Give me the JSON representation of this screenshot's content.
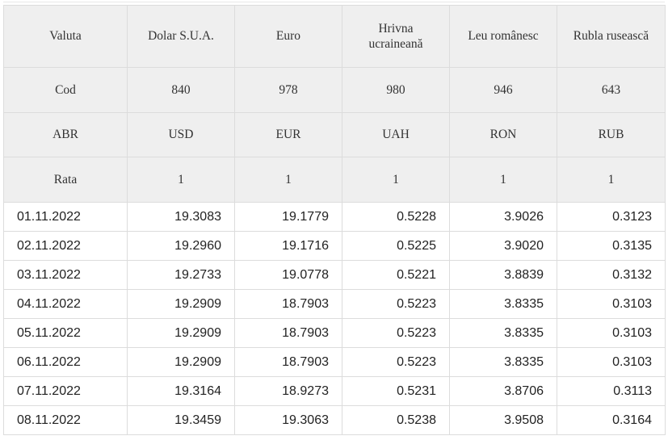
{
  "headers": {
    "valuta": [
      "Valuta",
      "Dolar S.U.A.",
      "Euro",
      "Hrivna ucraineană",
      "Leu românesc",
      "Rubla rusească"
    ],
    "cod": [
      "Cod",
      "840",
      "978",
      "980",
      "946",
      "643"
    ],
    "abr": [
      "ABR",
      "USD",
      "EUR",
      "UAH",
      "RON",
      "RUB"
    ],
    "rata": [
      "Rata",
      "1",
      "1",
      "1",
      "1",
      "1"
    ]
  },
  "rows": [
    [
      "01.11.2022",
      "19.3083",
      "19.1779",
      "0.5228",
      "3.9026",
      "0.3123"
    ],
    [
      "02.11.2022",
      "19.2960",
      "19.1716",
      "0.5225",
      "3.9020",
      "0.3135"
    ],
    [
      "03.11.2022",
      "19.2733",
      "19.0778",
      "0.5221",
      "3.8839",
      "0.3132"
    ],
    [
      "04.11.2022",
      "19.2909",
      "18.7903",
      "0.5223",
      "3.8335",
      "0.3103"
    ],
    [
      "05.11.2022",
      "19.2909",
      "18.7903",
      "0.5223",
      "3.8335",
      "0.3103"
    ],
    [
      "06.11.2022",
      "19.2909",
      "18.7903",
      "0.5223",
      "3.8335",
      "0.3103"
    ],
    [
      "07.11.2022",
      "19.3164",
      "18.9273",
      "0.5231",
      "3.8706",
      "0.3113"
    ],
    [
      "08.11.2022",
      "19.3459",
      "19.3063",
      "0.5238",
      "3.9508",
      "0.3164"
    ]
  ]
}
